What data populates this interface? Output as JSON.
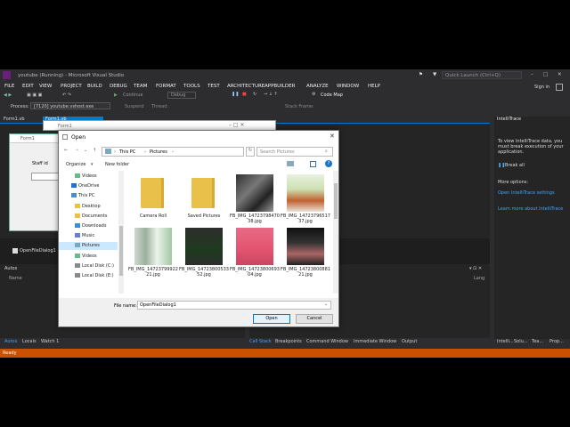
{
  "window": {
    "title": "youtube (Running) - Microsoft Visual Studio",
    "quick_launch": "Quick Launch (Ctrl+Q)",
    "sign_in": "Sign in"
  },
  "menu": [
    "FILE",
    "EDIT",
    "VIEW",
    "PROJECT",
    "BUILD",
    "DEBUG",
    "TEAM",
    "FORMAT",
    "TOOLS",
    "TEST",
    "ARCHITECTURE",
    "APPBUILDER",
    "ANALYZE",
    "WINDOW",
    "HELP"
  ],
  "toolbar": {
    "continue_label": "Continue",
    "config": "Debug",
    "code_map": "Code Map",
    "process_label": "Process:",
    "process_value": "[7120] youtube.vshost.exe",
    "suspend_label": "Suspend",
    "thread_label": "Thread:",
    "stack_frame_label": "Stack Frame:"
  },
  "doc_tabs": {
    "tab1": "Form1.vb",
    "tab2": "Form1.vb"
  },
  "designer": {
    "form_title": "Form1",
    "form_label": "Staff id",
    "tray_item": "OpenFileDialog1"
  },
  "behind_dialog": {
    "title": "Form1"
  },
  "panels": {
    "autos_title": "Autos",
    "autos_col_name": "Name",
    "autos_col_lang": "Lang"
  },
  "bottom_tabs_left": [
    "Autos",
    "Locals",
    "Watch 1"
  ],
  "bottom_tabs_right": [
    "Call Stack",
    "Breakpoints",
    "Command Window",
    "Immediate Window",
    "Output"
  ],
  "right_tabs": [
    "Intelli...",
    "Solu...",
    "Tea...",
    "Prop..."
  ],
  "intellitrace": {
    "title": "IntelliTrace",
    "text": "To view IntelliTrace data, you must break execution of your application.",
    "break_all": "Break all",
    "more_options": "More options:",
    "open_settings": "Open IntelliTrace settings",
    "learn_more": "Learn more about IntelliTrace"
  },
  "status": {
    "text": "Ready"
  },
  "dialog": {
    "title": "Open",
    "breadcrumb": [
      "This PC",
      "Pictures"
    ],
    "search_placeholder": "Search Pictures",
    "organize": "Organize",
    "new_folder": "New folder",
    "nav": [
      {
        "label": "Videos",
        "icon": "videos-icon"
      },
      {
        "label": "OneDrive",
        "icon": "onedrive-icon"
      },
      {
        "label": "This PC",
        "icon": "pc-icon"
      },
      {
        "label": "Desktop",
        "icon": "folder-icon"
      },
      {
        "label": "Documents",
        "icon": "folder-icon"
      },
      {
        "label": "Downloads",
        "icon": "downloads-icon"
      },
      {
        "label": "Music",
        "icon": "music-icon"
      },
      {
        "label": "Pictures",
        "icon": "pictures-icon"
      },
      {
        "label": "Videos",
        "icon": "videos-icon"
      },
      {
        "label": "Local Disk (C:)",
        "icon": "disk-icon"
      },
      {
        "label": "Local Disk (E:)",
        "icon": "disk-icon"
      }
    ],
    "files": [
      {
        "name": "Camera Roll",
        "kind": "folder-icon"
      },
      {
        "name": "Saved Pictures",
        "kind": "folder-icon"
      },
      {
        "name": "FB_IMG_1472379847038.jpg",
        "kind": "image-thumbnail"
      },
      {
        "name": "FB_IMG_1472379651737.jpg",
        "kind": "image-thumbnail"
      },
      {
        "name": "FB_IMG_1472379992221.jpg",
        "kind": "image-thumbnail"
      },
      {
        "name": "FB_IMG_1472380053352.jpg",
        "kind": "image-thumbnail"
      },
      {
        "name": "FB_IMG_1472380069304.jpg",
        "kind": "image-thumbnail"
      },
      {
        "name": "FB_IMG_1472380088121.jpg",
        "kind": "image-thumbnail"
      }
    ],
    "file_name_label": "File name:",
    "file_name_value": "OpenFileDialog1",
    "open_button": "Open",
    "cancel_button": "Cancel"
  },
  "colors": {
    "vs_bg": "#2d2d30",
    "accent": "#007acc",
    "status": "#ca5100",
    "folder": "#e8c04a"
  }
}
